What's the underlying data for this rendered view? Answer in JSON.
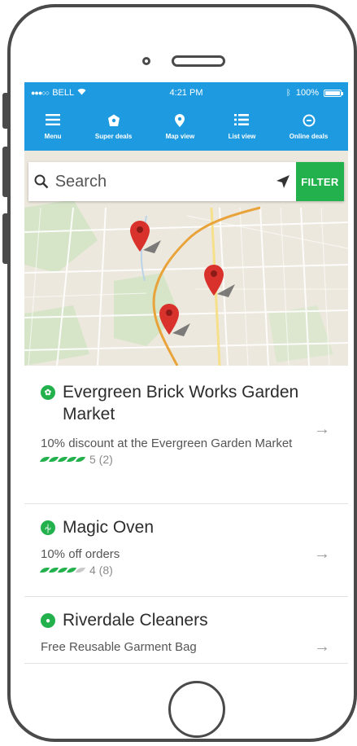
{
  "status_bar": {
    "carrier": "BELL",
    "time": "4:21 PM",
    "battery": "100%"
  },
  "nav": [
    {
      "label": "Menu",
      "icon": "menu-icon"
    },
    {
      "label": "Super deals",
      "icon": "deal-tag-icon"
    },
    {
      "label": "Map view",
      "icon": "map-pin-icon"
    },
    {
      "label": "List view",
      "icon": "list-icon"
    },
    {
      "label": "Online deals",
      "icon": "online-deal-icon"
    }
  ],
  "search": {
    "placeholder": "Search",
    "filter_label": "FILTER"
  },
  "listings": [
    {
      "title": "Evergreen Brick Works Garden Market",
      "description": "10% discount at the Evergreen Garden Market",
      "rating": 5,
      "rating_text": "5 (2)",
      "category_icon": "leaf-badge-icon"
    },
    {
      "title": "Magic Oven",
      "description": "10% off orders",
      "rating": 4,
      "rating_text": "4 (8)",
      "category_icon": "restaurant-icon"
    },
    {
      "title": "Riverdale Cleaners",
      "description": "Free Reusable Garment Bag",
      "category_icon": "cleaning-icon"
    }
  ],
  "colors": {
    "brand_blue": "#1e9be0",
    "accent_green": "#23b14d",
    "map_background": "#ede8dd",
    "pin_red": "#d9312b",
    "river_orange": "#e8a33a"
  }
}
